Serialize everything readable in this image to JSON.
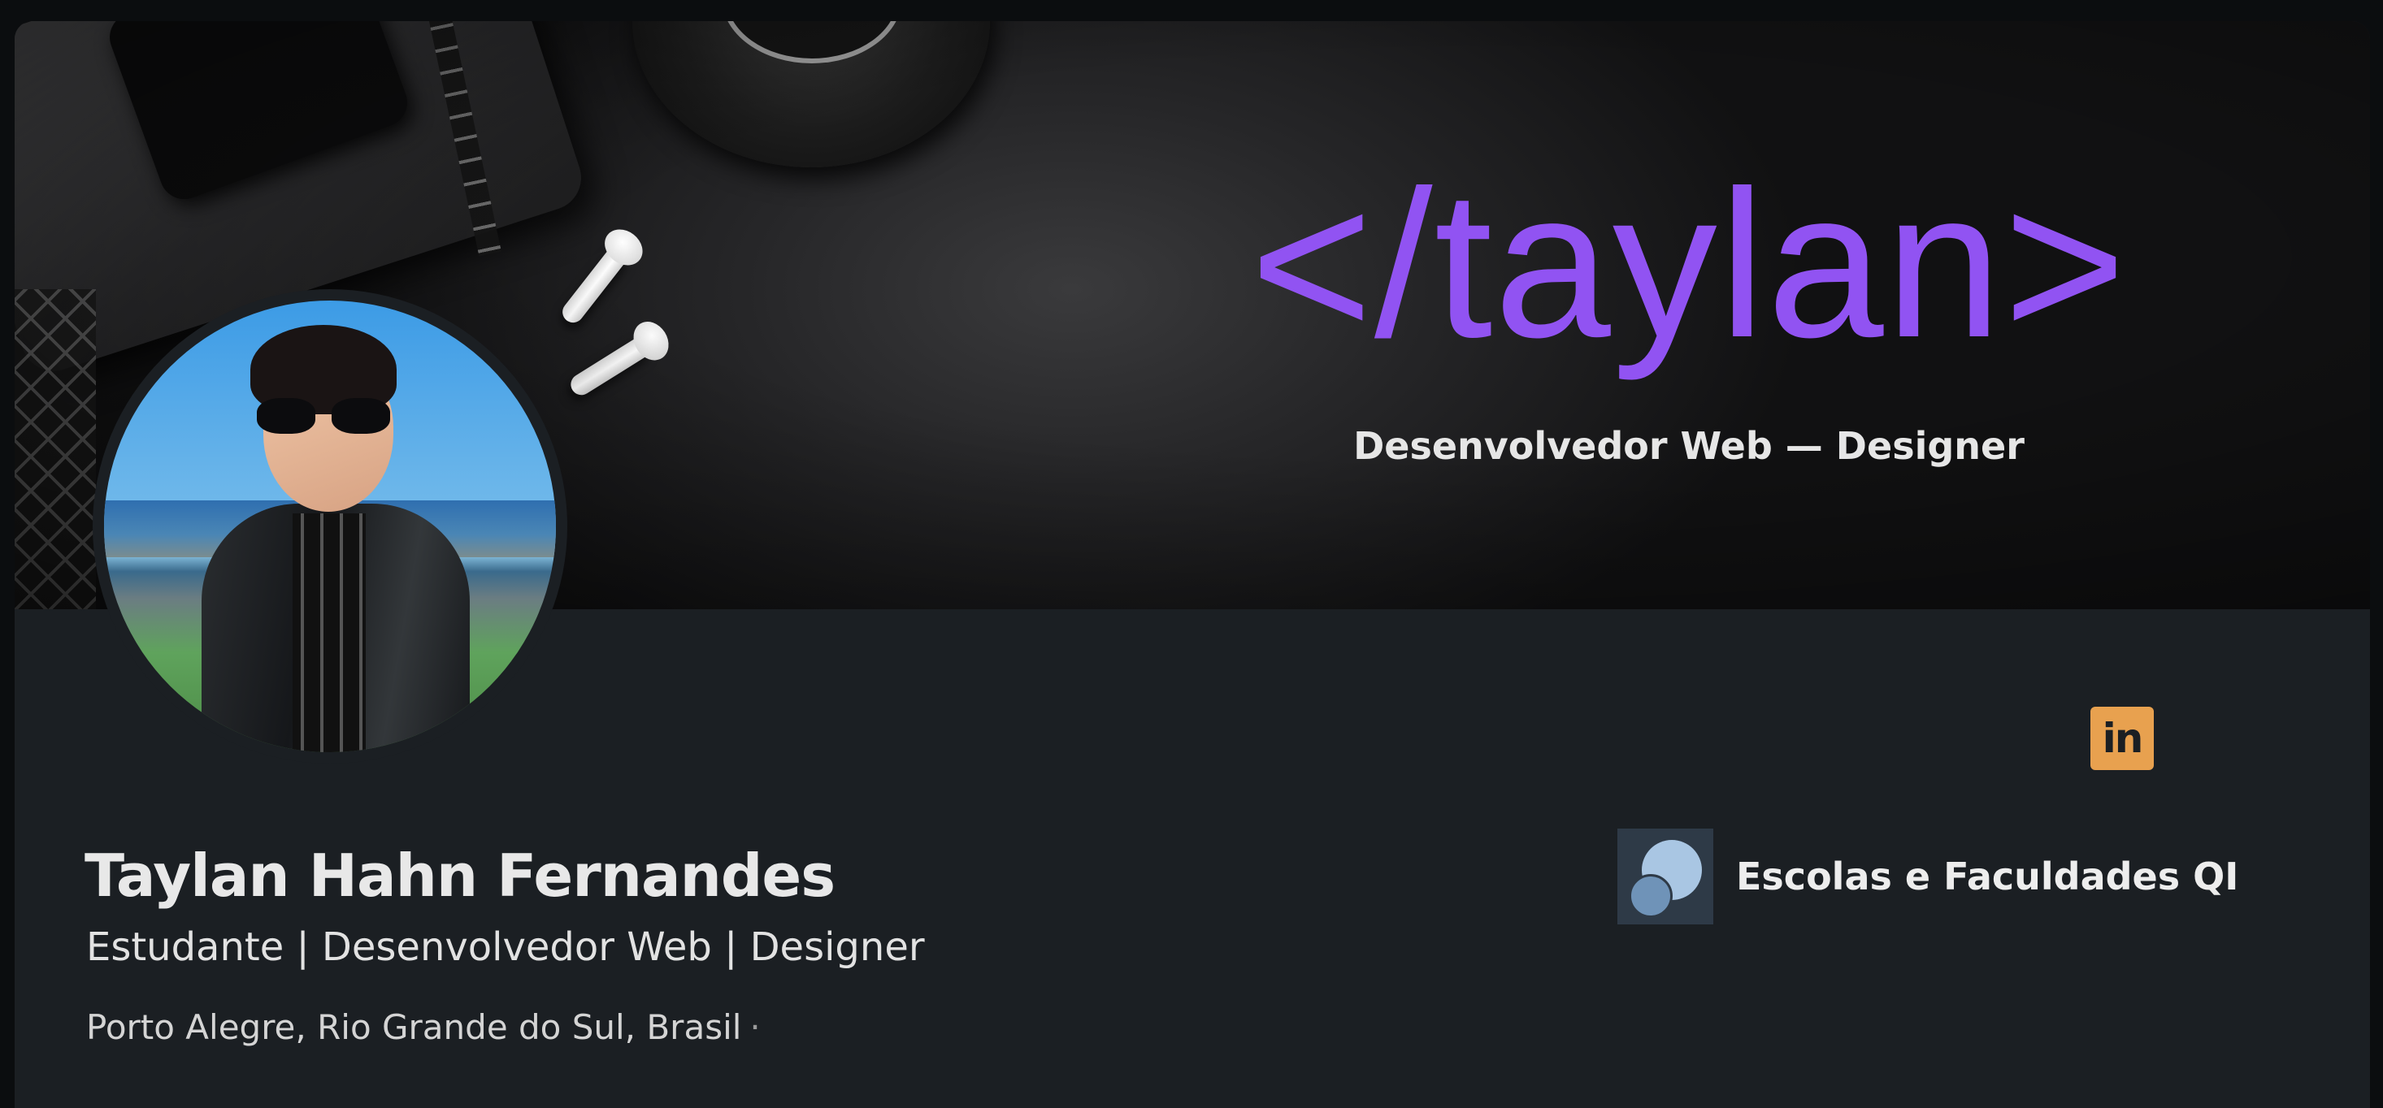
{
  "banner": {
    "logo_text": "</taylan>",
    "subtitle": "Desenvolvedor Web — Designer"
  },
  "profile": {
    "name": "Taylan Hahn Fernandes",
    "headline": "Estudante | Desenvolvedor Web | Designer",
    "location": "Porto Alegre, Rio Grande do Sul, Brasil",
    "location_separator": "·"
  },
  "company": {
    "name": "Escolas e Faculdades QI"
  },
  "social": {
    "linkedin_label": "in"
  },
  "colors": {
    "brand_purple": "#9153f2",
    "card_bg": "#1b1f23",
    "linkedin_badge": "#e8a14f"
  },
  "icons": [
    "linkedin-icon",
    "company-logo-icon"
  ]
}
